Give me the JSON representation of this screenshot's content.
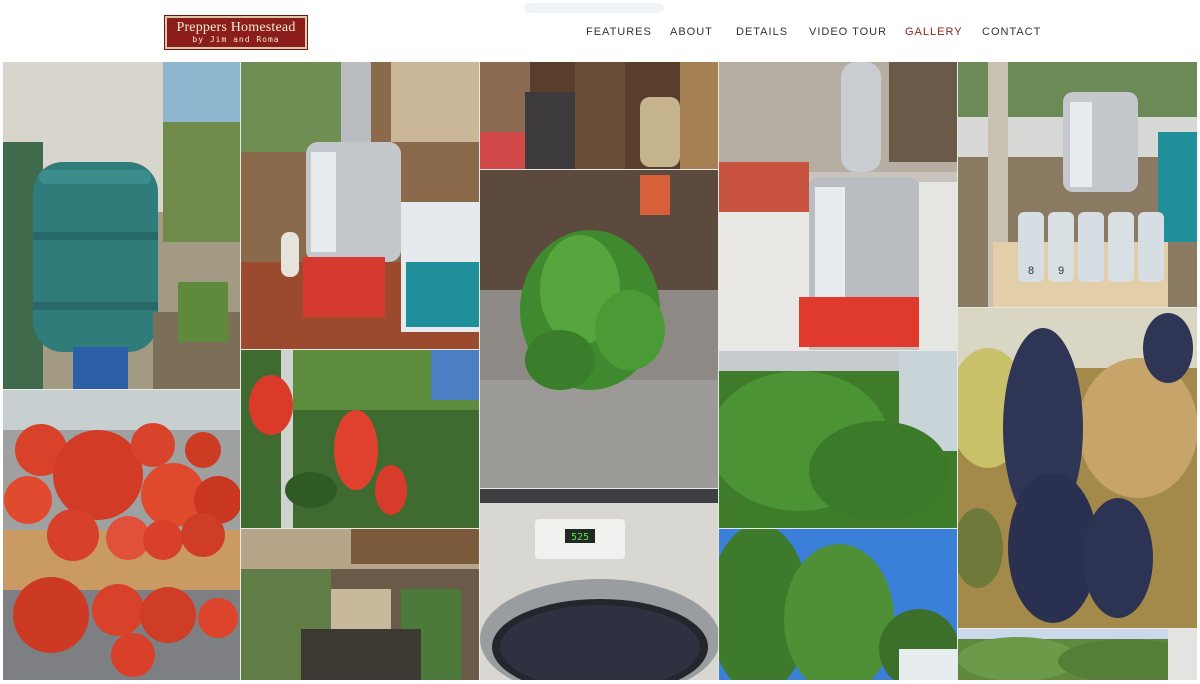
{
  "site": {
    "logo_line1": "Preppers Homestead",
    "logo_line2": "by Jim and Roma"
  },
  "nav": {
    "items": [
      {
        "label": "FEATURES"
      },
      {
        "label": "ABOUT"
      },
      {
        "label": "DETAILS"
      },
      {
        "label": "VIDEO TOUR"
      },
      {
        "label": "GALLERY",
        "active": true
      },
      {
        "label": "CONTACT"
      }
    ]
  },
  "stove_display": "525",
  "jar_labels": [
    "8",
    "9"
  ],
  "colors": {
    "brand": "#8b1e1a",
    "nav_text": "#333333",
    "nav_active": "#8b1e1a"
  }
}
